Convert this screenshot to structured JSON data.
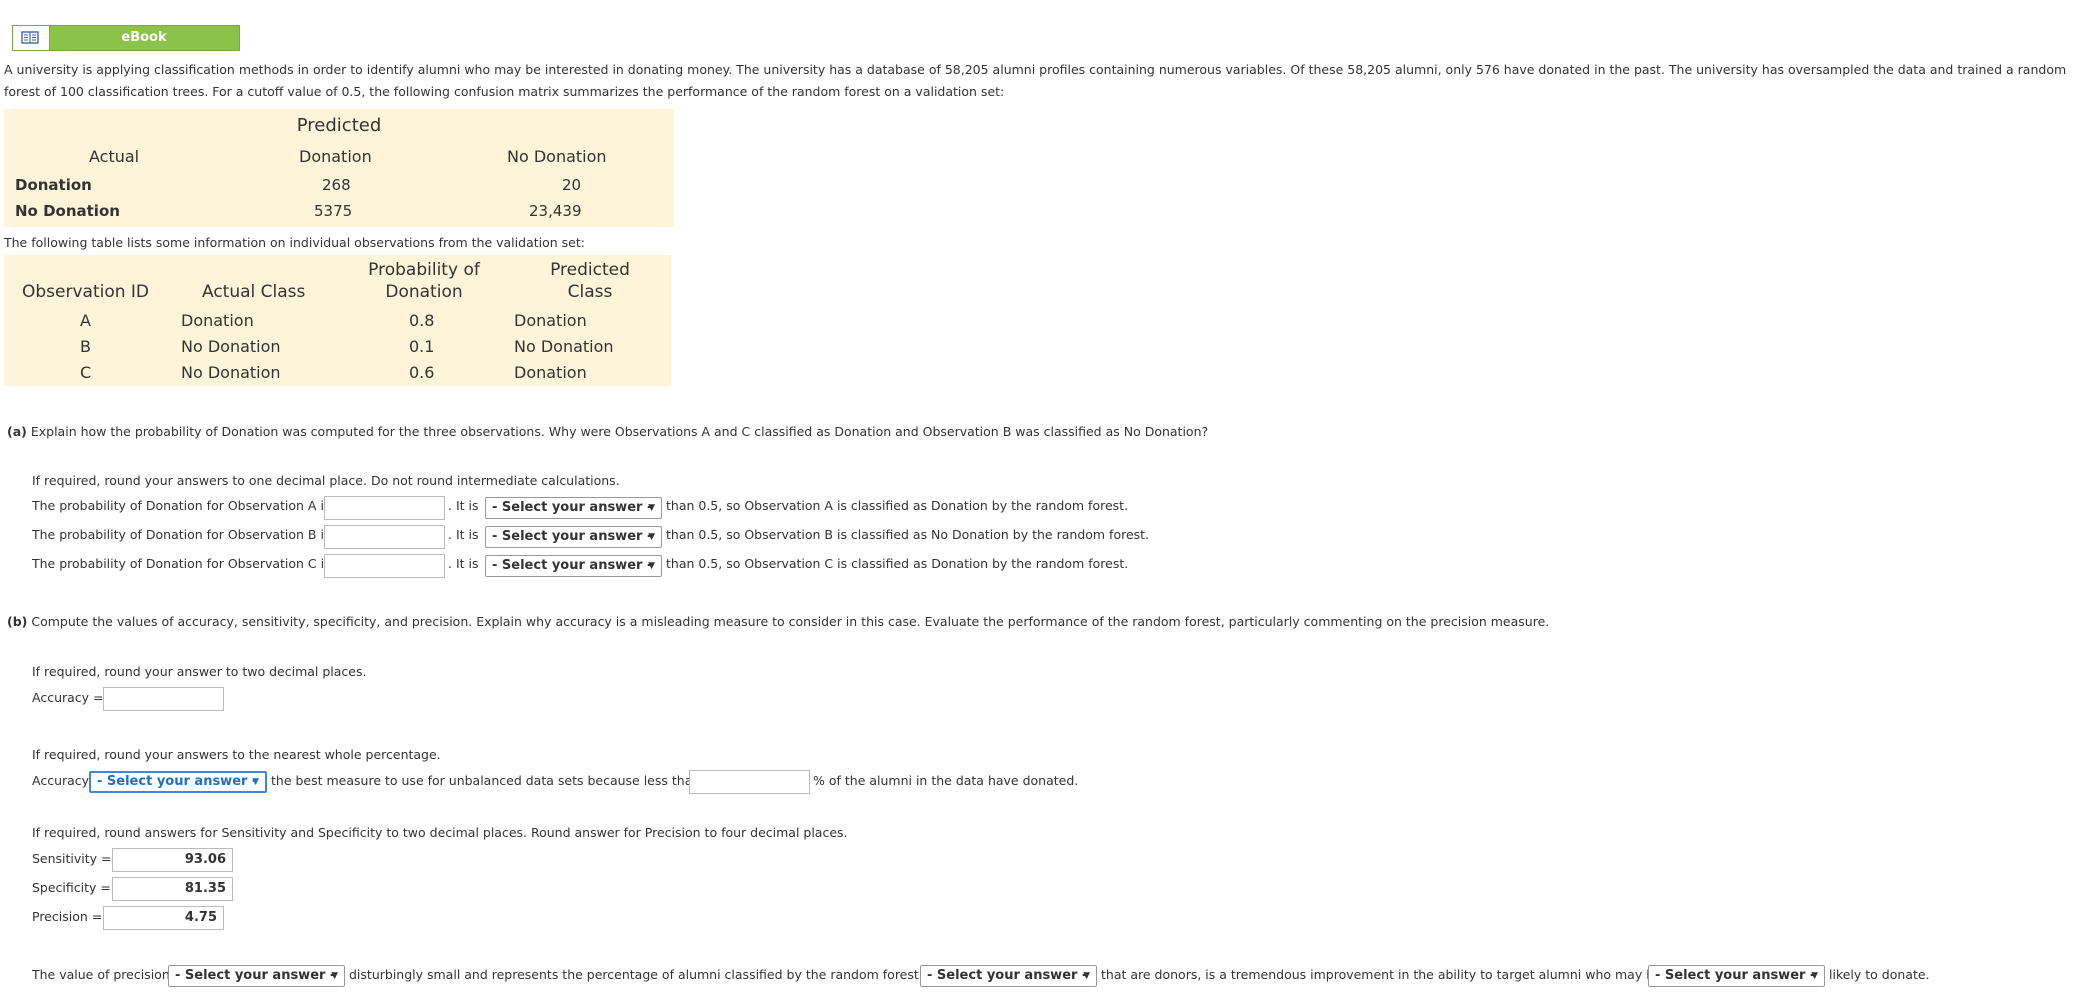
{
  "ebook": {
    "label": "eBook",
    "icon": "book-icon"
  },
  "intro": "A university is applying classification methods in order to identify alumni who may be interested in donating money. The university has a database of 58,205 alumni profiles containing numerous variables. Of these 58,205 alumni, only 576 have donated in the past. The university has oversampled the data and trained a random forest of 100 classification trees. For a cutoff value of 0.5, the following confusion matrix summarizes the performance of the random forest on a validation set:",
  "confusion": {
    "predicted_header": "Predicted",
    "actual_header": "Actual",
    "col1": "Donation",
    "col2": "No Donation",
    "rows": [
      {
        "label": "Donation",
        "v1": "268",
        "v2": "20"
      },
      {
        "label": "No Donation",
        "v1": "5375",
        "v2": "23,439"
      }
    ]
  },
  "obs_intro": "The following table lists some information on individual observations from the validation set:",
  "observations": {
    "headers": [
      "Observation ID",
      "Actual Class",
      "Probability of",
      "Donation",
      "Predicted",
      "Class"
    ],
    "rows": [
      {
        "id": "A",
        "actual": "Donation",
        "prob": "0.8",
        "pred": "Donation"
      },
      {
        "id": "B",
        "actual": "No Donation",
        "prob": "0.1",
        "pred": "No Donation"
      },
      {
        "id": "C",
        "actual": "No Donation",
        "prob": "0.6",
        "pred": "Donation"
      }
    ]
  },
  "part_a": {
    "tag": "(a)",
    "question": "Explain how the probability of Donation was computed for the three observations. Why were Observations A and C classified as Donation and Observation B was classified as No Donation?",
    "instruction": "If required, round your answers to one decimal place. Do not round intermediate calculations.",
    "lines": [
      {
        "pre": "The probability of Donation for Observation A is",
        "mid": ". It is",
        "post": "than 0.5, so Observation A is classified as Donation by the random forest.",
        "value": "",
        "select": "- Select your answer -"
      },
      {
        "pre": "The probability of Donation for Observation B is",
        "mid": ". It is",
        "post": "than 0.5, so Observation B is classified as No Donation by the random forest.",
        "value": "",
        "select": "- Select your answer -"
      },
      {
        "pre": "The probability of Donation for Observation C is",
        "mid": ". It is",
        "post": "than 0.5, so Observation C is classified as Donation by the random forest.",
        "value": "",
        "select": "- Select your answer -"
      }
    ]
  },
  "part_b": {
    "tag": "(b)",
    "question": "Compute the values of accuracy, sensitivity, specificity, and precision. Explain why accuracy is a misleading measure to consider in this case. Evaluate the performance of the random forest, particularly commenting on the precision measure.",
    "instr1": "If required, round your answer to two decimal places.",
    "accuracy_label": "Accuracy =",
    "accuracy_value": "",
    "instr2": "If required, round your answers to the nearest whole percentage.",
    "acc2_pre": "Accuracy",
    "acc2_select": "- Select your answer -",
    "acc2_mid": "the best measure to use for unbalanced data sets because less than",
    "acc2_value": "",
    "acc2_post": "% of the alumni in the data have donated.",
    "instr3": "If required, round answers for Sensitivity and Specificity to two decimal places. Round answer for Precision to four decimal places.",
    "sensitivity_label": "Sensitivity =",
    "sensitivity_value": "93.06",
    "specificity_label": "Specificity =",
    "specificity_value": "81.35",
    "precision_label": "Precision =",
    "precision_value": "4.75",
    "final_pre": "The value of precision",
    "final_sel1": "- Select your answer -",
    "final_mid1": "disturbingly small and represents the percentage of alumni classified by the random forest as",
    "final_sel2": "- Select your answer -",
    "final_mid2": "that are donors, is a tremendous improvement in the ability to target alumni who may be",
    "final_sel3": "- Select your answer -",
    "final_post": "likely to donate."
  },
  "colors": {
    "ebook_green": "#8bc34a",
    "table_bg": "#fdf4d9",
    "select_blue": "#3b8ad9"
  }
}
